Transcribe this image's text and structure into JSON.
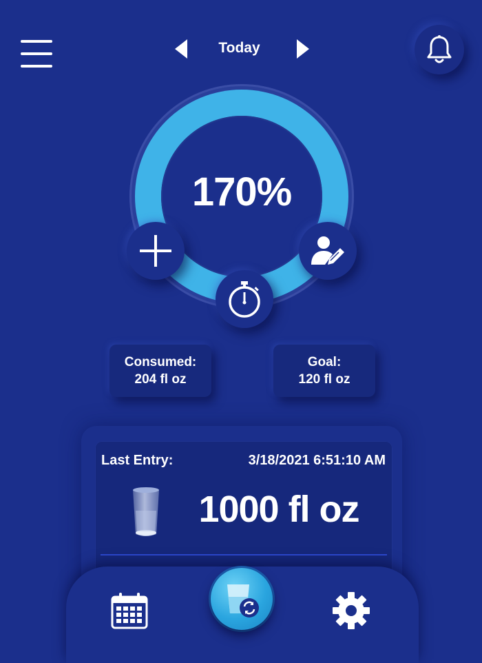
{
  "header": {
    "title": "Today"
  },
  "progress": {
    "percent_label": "170%",
    "fraction": 1.7
  },
  "stats": {
    "consumed_label": "Consumed:",
    "consumed_value": "204 fl oz",
    "goal_label": "Goal:",
    "goal_value": "120 fl oz"
  },
  "last_entry": {
    "label": "Last Entry:",
    "timestamp": "3/18/2021 6:51:10 AM",
    "amount": "1000 fl oz"
  },
  "icons": {
    "menu": "hamburger-menu-icon",
    "prev": "arrow-left-icon",
    "next": "arrow-right-icon",
    "notifications": "bell-icon",
    "add": "plus-icon",
    "edit_profile": "user-edit-icon",
    "timer": "stopwatch-icon",
    "glass": "water-glass-icon",
    "calendar": "calendar-icon",
    "refill": "glass-refresh-icon",
    "settings": "gear-icon"
  },
  "colors": {
    "background": "#1b2f8c",
    "ring": "#3fb3e8",
    "card": "#17297d",
    "accent_button": "#2aa5df"
  }
}
